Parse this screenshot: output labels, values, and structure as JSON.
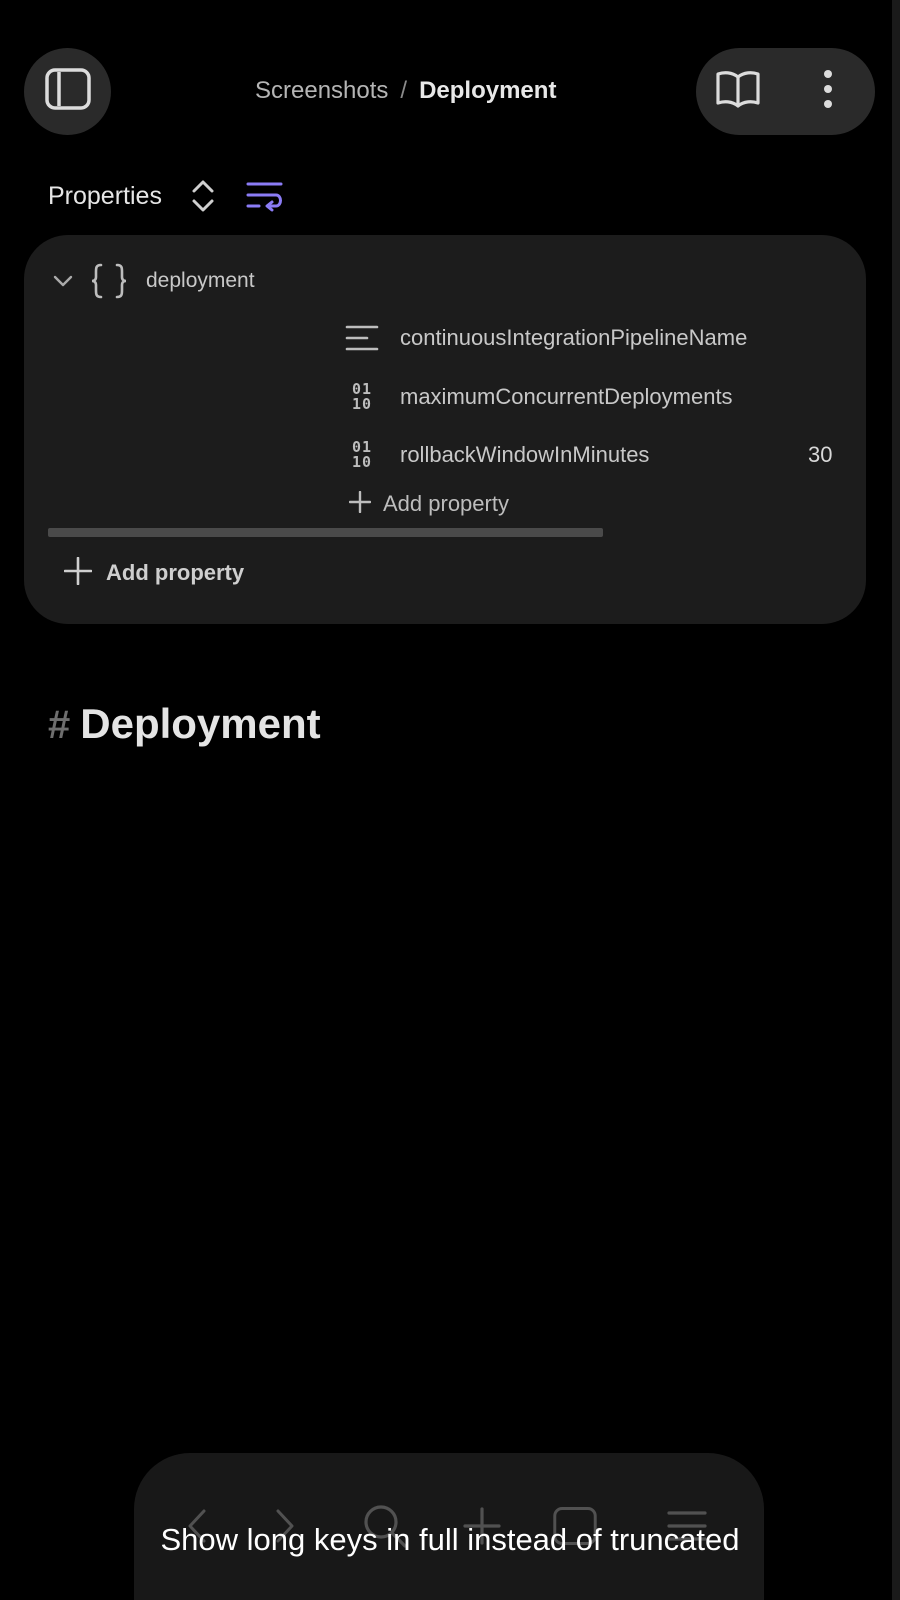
{
  "header": {
    "breadcrumb_parent": "Screenshots",
    "breadcrumb_separator": "/",
    "breadcrumb_current": "Deployment"
  },
  "properties": {
    "title": "Properties",
    "root_key": "deployment",
    "items": [
      {
        "key": "continuousIntegrationPipelineName",
        "type_icon": "text-icon",
        "value": ""
      },
      {
        "key": "maximumConcurrentDeployments",
        "type_icon": "number-icon",
        "value": ""
      },
      {
        "key": "rollbackWindowInMinutes",
        "type_icon": "number-icon",
        "value": "30"
      }
    ],
    "add_nested_label": "Add property",
    "add_label": "Add property"
  },
  "document": {
    "heading_marker": "#",
    "heading": "Deployment"
  },
  "caption": "Show long keys in full instead of truncated",
  "colors": {
    "background": "#000000",
    "card": "#1c1c1c",
    "accent": "#8b7cf6"
  }
}
